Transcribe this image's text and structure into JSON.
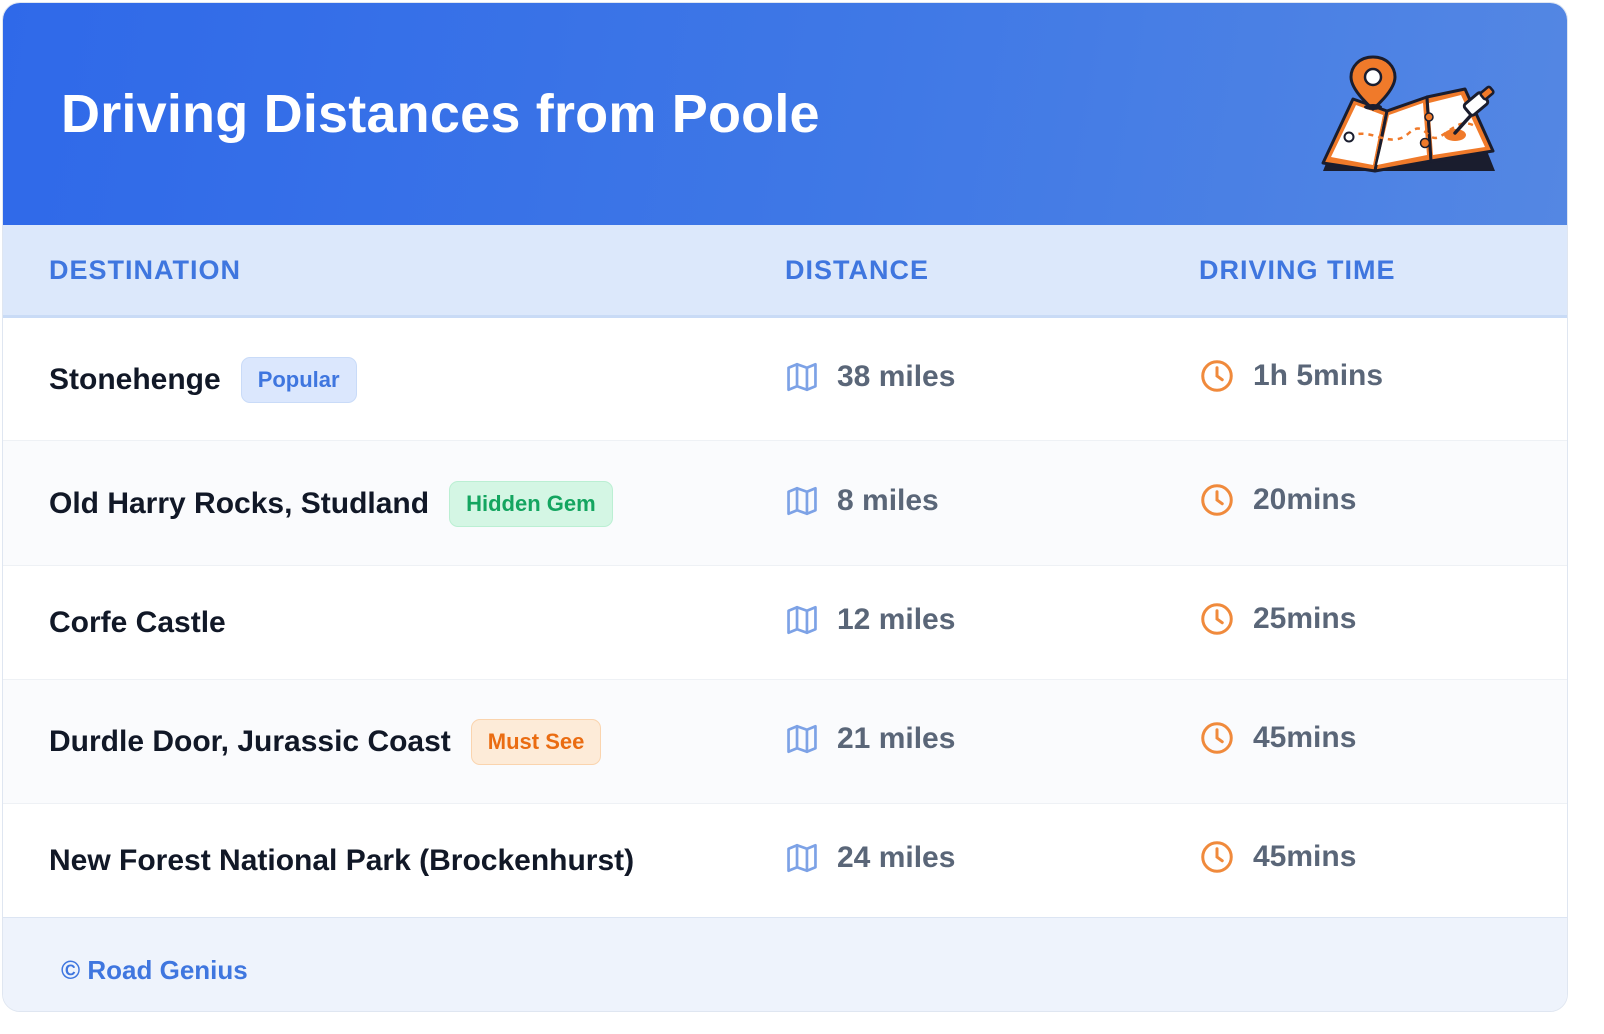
{
  "header": {
    "title": "Driving Distances from Poole",
    "illustration": "folded-map-with-location-pin-icon"
  },
  "table": {
    "columns": [
      "DESTINATION",
      "DISTANCE",
      "DRIVING TIME"
    ],
    "distance_icon": "map-icon",
    "time_icon": "clock-icon",
    "rows": [
      {
        "destination": "Stonehenge",
        "badge": "Popular",
        "badge_color": "blue",
        "distance": "38 miles",
        "time": "1h 5mins"
      },
      {
        "destination": "Old Harry Rocks, Studland",
        "badge": "Hidden Gem",
        "badge_color": "green",
        "distance": "8 miles",
        "time": "20mins"
      },
      {
        "destination": "Corfe Castle",
        "badge": "",
        "badge_color": "",
        "distance": "12 miles",
        "time": "25mins"
      },
      {
        "destination": "Durdle Door, Jurassic Coast",
        "badge": "Must See",
        "badge_color": "orange",
        "distance": "21 miles",
        "time": "45mins"
      },
      {
        "destination": "New Forest National Park (Brockenhurst)",
        "badge": "",
        "badge_color": "",
        "distance": "24 miles",
        "time": "45mins"
      }
    ]
  },
  "footer": {
    "credit": "© Road Genius"
  },
  "colors": {
    "header_start": "#2f69e9",
    "header_end": "#5487e3",
    "accent_blue": "#3f76df",
    "accent_orange": "#f08a3c",
    "badge_green": "#14a560",
    "badge_orange": "#ea6c12"
  }
}
